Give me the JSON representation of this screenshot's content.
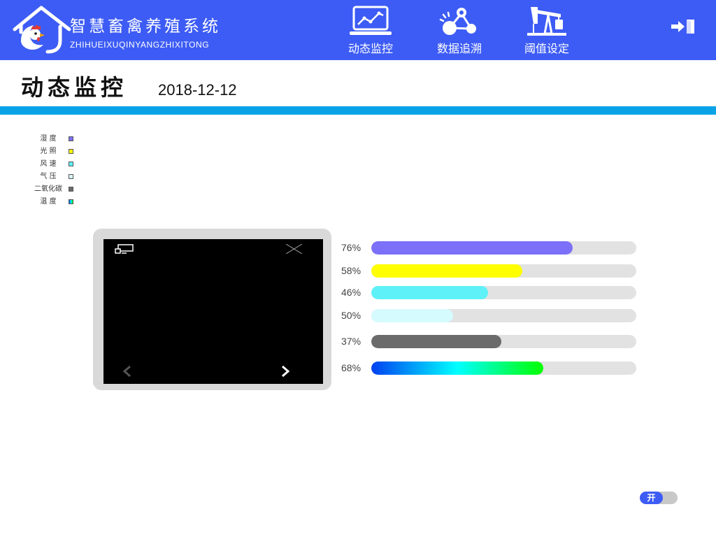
{
  "colors": {
    "header_bg": "#3d5cf5",
    "stripe": "#0aa2e6",
    "track": "#e2e2e2",
    "panel": "#d9d9d9"
  },
  "header": {
    "app_title": "智慧畜禽养殖系统",
    "app_subtitle": "ZHIHUEIXUQINYANGZHIXITONG",
    "logo_icon": "rooster-house-logo",
    "nav": [
      {
        "label": "动态监控",
        "icon": "chart-monitor-icon"
      },
      {
        "label": "数据追溯",
        "icon": "network-icon"
      },
      {
        "label": "阈值设定",
        "icon": "oil-pump-icon"
      }
    ],
    "logout_icon": "logout-icon"
  },
  "page": {
    "title": "动态监控",
    "date": "2018-12-12"
  },
  "legend": [
    {
      "label": "湿 度",
      "color": "#7b70f7"
    },
    {
      "label": "光 照",
      "color": "#ffff00"
    },
    {
      "label": "风 速",
      "color": "#5ef2f8"
    },
    {
      "label": "气 压",
      "color": "#d6fbfe"
    },
    {
      "label": "二氧化碳",
      "color": "#6b6b6b"
    },
    {
      "label": "温 度",
      "gradient": [
        "#0040f0",
        "#00ffff",
        "#00ff00"
      ]
    }
  ],
  "video": {
    "cast_icon": "cast-icon",
    "close_icon": "close-icon",
    "prev_icon": "chevron-left-icon",
    "next_icon": "chevron-right-icon"
  },
  "meters": [
    {
      "label": "76%",
      "fill": 0.76,
      "color": "#7b70f7"
    },
    {
      "label": "58%",
      "fill": 0.57,
      "color": "#ffff00"
    },
    {
      "label": "46%",
      "fill": 0.44,
      "color": "#5ef2f8"
    },
    {
      "label": "50%",
      "fill": 0.31,
      "color": "#d6fbfe"
    },
    {
      "label": "37%",
      "fill": 0.49,
      "color": "#6b6b6b"
    },
    {
      "label": "68%",
      "fill": 0.65,
      "gradient": [
        "#0040f0",
        "#00ffff",
        "#00ff00"
      ]
    }
  ],
  "toggle": {
    "label": "开",
    "state": "on"
  }
}
